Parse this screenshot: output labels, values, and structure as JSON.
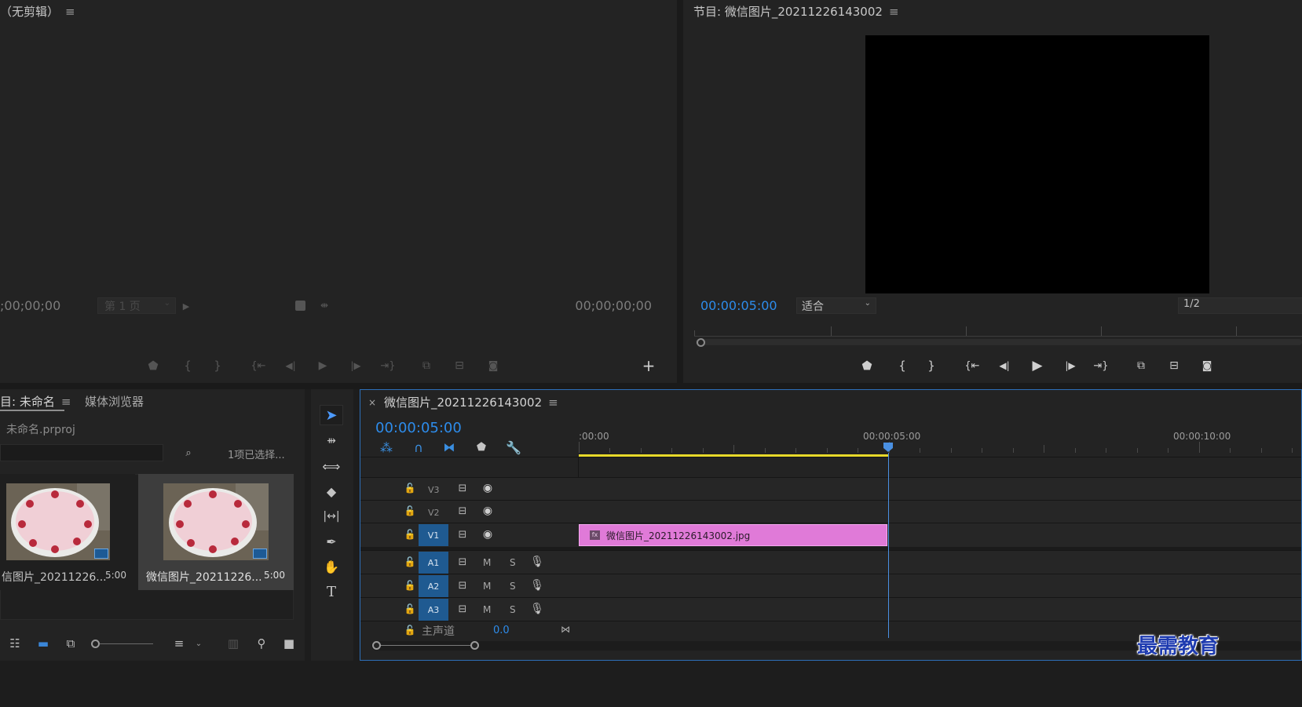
{
  "source_monitor": {
    "title": "（无剪辑）",
    "timecode_left": ";00;00;00",
    "page_select": "第 1 页",
    "timecode_right": "00;00;00;00"
  },
  "program_monitor": {
    "title": "节目: 微信图片_20211226143002",
    "timecode": "00:00:05:00",
    "fit_select": "适合",
    "resolution_select": "1/2"
  },
  "project": {
    "tab_project": "目: 未命名",
    "tab_media_browser": "媒体浏览器",
    "file_name": "未命名.prproj",
    "selection_status": "1项已选择...",
    "items": [
      {
        "name": "信图片_20211226...",
        "duration": "5:00"
      },
      {
        "name": "微信图片_20211226...",
        "duration": "5:00"
      }
    ]
  },
  "timeline": {
    "close_label": "×",
    "sequence_title": "微信图片_20211226143002",
    "timecode": "00:00:05:00",
    "ruler_labels": [
      ":00:00",
      "00:00:05:00",
      "00:00:10:00"
    ],
    "video_tracks": [
      "V3",
      "V2",
      "V1"
    ],
    "audio_tracks": [
      "A1",
      "A2",
      "A3"
    ],
    "mute_label": "M",
    "solo_label": "S",
    "master_label": "主声道",
    "master_value": "0.0",
    "clip": {
      "fx": "fx",
      "name": "微信图片_20211226143002.jpg",
      "color": "#e07ad8"
    }
  },
  "watermark": "最需教育",
  "colors": {
    "accent": "#2d8ceb",
    "track_target": "#1f5a91",
    "clip": "#e07ad8",
    "work_area": "#e7d92a",
    "playhead": "#4a90e2"
  }
}
